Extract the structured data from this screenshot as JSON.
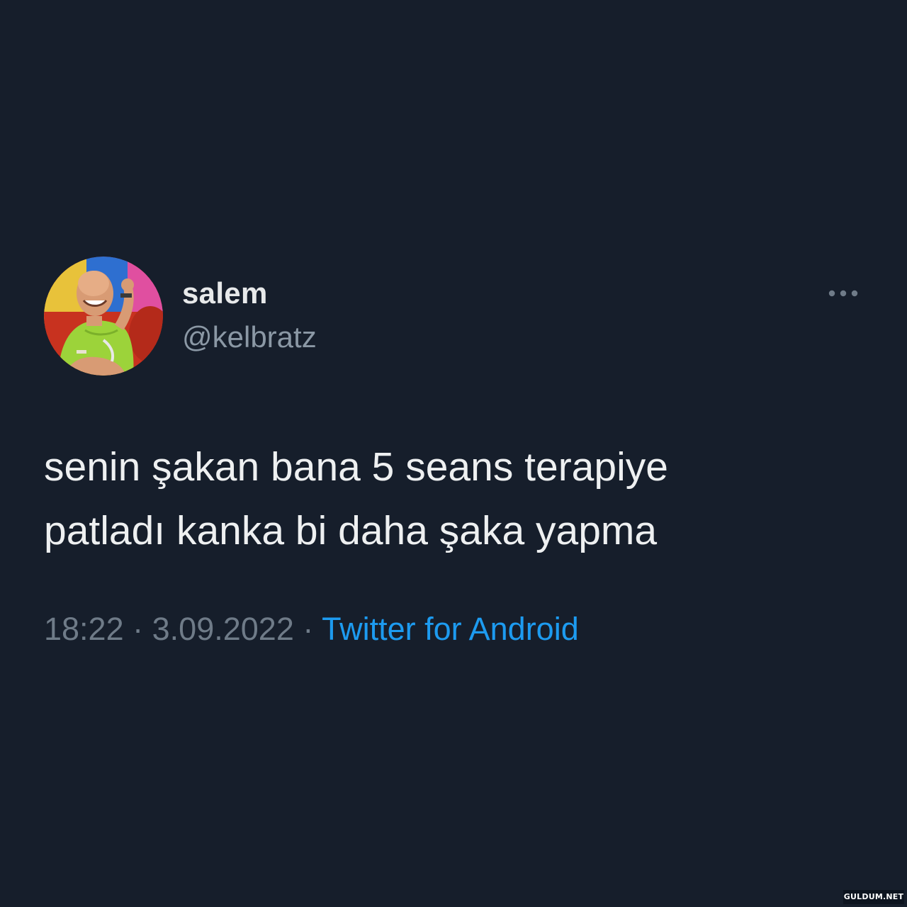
{
  "tweet": {
    "display_name": "salem",
    "handle": "@kelbratz",
    "text_lines": [
      "senin şakan bana 5 seans terapiye",
      "patladı kanka bi daha şaka yapma"
    ],
    "time": "18:22",
    "separator": "·",
    "date": "3.09.2022",
    "source": "Twitter for Android"
  },
  "icons": {
    "more": "more-horizontal-icon",
    "avatar": "profile-avatar"
  },
  "watermark": "GULDUM.NET",
  "colors": {
    "background": "#161e2b",
    "primary_text": "#e7e9ea",
    "secondary_text": "#8b98a5",
    "link": "#1d9bf0"
  }
}
